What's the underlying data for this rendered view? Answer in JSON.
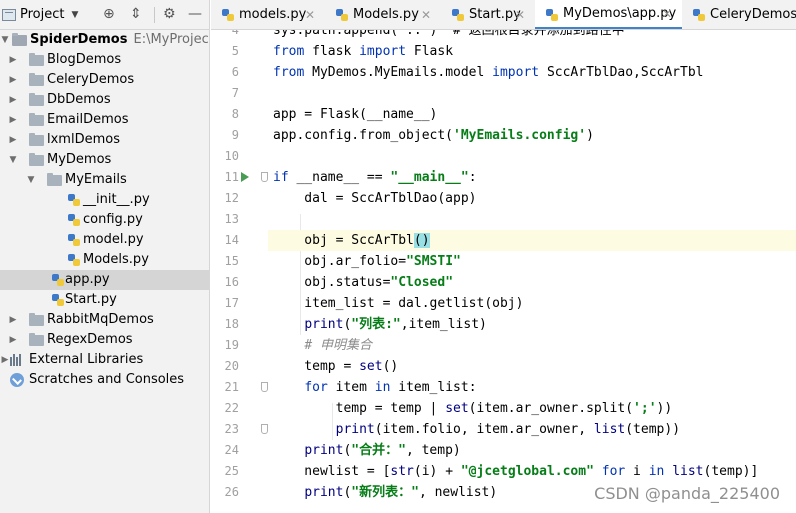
{
  "project_panel": {
    "title": "Project",
    "tools": [
      "locate-icon",
      "collapse-icon",
      "gear-icon",
      "hide-icon"
    ],
    "tree": [
      {
        "label": "SpiderDemos",
        "path": "E:\\MyProject\\My",
        "type": "root",
        "expanded": true,
        "depth": 0
      },
      {
        "label": "BlogDemos",
        "type": "folder",
        "expanded": false,
        "depth": 1
      },
      {
        "label": "CeleryDemos",
        "type": "folder",
        "expanded": false,
        "depth": 1
      },
      {
        "label": "DbDemos",
        "type": "folder",
        "expanded": false,
        "depth": 1
      },
      {
        "label": "EmailDemos",
        "type": "folder",
        "expanded": false,
        "depth": 1
      },
      {
        "label": "lxmlDemos",
        "type": "folder",
        "expanded": false,
        "depth": 1
      },
      {
        "label": "MyDemos",
        "type": "folder",
        "expanded": true,
        "depth": 1
      },
      {
        "label": "MyEmails",
        "type": "folder",
        "expanded": true,
        "depth": 2
      },
      {
        "label": "__init__.py",
        "type": "pyfile",
        "depth": 3
      },
      {
        "label": "config.py",
        "type": "pyfile",
        "depth": 3
      },
      {
        "label": "model.py",
        "type": "pyfile",
        "depth": 3
      },
      {
        "label": "Models.py",
        "type": "pyfile",
        "depth": 3
      },
      {
        "label": "app.py",
        "type": "pyfile",
        "depth": 2,
        "selected": true
      },
      {
        "label": "Start.py",
        "type": "pyfile",
        "depth": 2
      },
      {
        "label": "RabbitMqDemos",
        "type": "folder",
        "expanded": false,
        "depth": 1
      },
      {
        "label": "RegexDemos",
        "type": "folder",
        "expanded": false,
        "depth": 1
      },
      {
        "label": "External Libraries",
        "type": "libs",
        "expanded": false,
        "depth": 0
      },
      {
        "label": "Scratches and Consoles",
        "type": "scratch",
        "depth": 0
      }
    ]
  },
  "tabs": [
    {
      "label": "models.py",
      "active": false
    },
    {
      "label": "Models.py",
      "active": false
    },
    {
      "label": "Start.py",
      "active": false
    },
    {
      "label": "MyDemos\\app.py",
      "active": true
    },
    {
      "label": "CeleryDemos\\a",
      "active": false
    }
  ],
  "editor": {
    "lines": [
      {
        "num": "4",
        "segments": [
          [
            "",
            "sys.path.append(\"..\")  # 返回根目录并添加到路径中"
          ]
        ]
      },
      {
        "num": "5",
        "segments": [
          [
            "kw",
            "from"
          ],
          [
            "",
            " flask "
          ],
          [
            "kw",
            "import"
          ],
          [
            "",
            " Flask"
          ]
        ]
      },
      {
        "num": "6",
        "segments": [
          [
            "kw",
            "from"
          ],
          [
            "",
            " MyDemos.MyEmails.model "
          ],
          [
            "kw",
            "import"
          ],
          [
            "",
            " SccArTblDao,SccArTbl"
          ]
        ]
      },
      {
        "num": "7",
        "segments": []
      },
      {
        "num": "8",
        "segments": [
          [
            "",
            "app = Flask(__name__)"
          ]
        ]
      },
      {
        "num": "9",
        "segments": [
          [
            "",
            "app.config.from_object("
          ],
          [
            "str",
            "'MyEmails.config'"
          ],
          [
            "",
            ")"
          ]
        ]
      },
      {
        "num": "10",
        "segments": []
      },
      {
        "num": "11",
        "segments": [
          [
            "kw",
            "if"
          ],
          [
            "",
            " __name__ == "
          ],
          [
            "str",
            "\"__main__\""
          ],
          [
            "",
            ":"
          ]
        ],
        "run": true,
        "fold": true
      },
      {
        "num": "12",
        "segments": [
          [
            "",
            "    dal = SccArTblDao(app)"
          ]
        ]
      },
      {
        "num": "13",
        "segments": []
      },
      {
        "num": "14",
        "segments": [
          [
            "",
            "    obj = SccArTbl"
          ],
          [
            "cursor",
            "()"
          ]
        ],
        "current": true,
        "bulb": true
      },
      {
        "num": "15",
        "segments": [
          [
            "",
            "    obj.ar_folio="
          ],
          [
            "str",
            "\"SMSTI\""
          ]
        ]
      },
      {
        "num": "16",
        "segments": [
          [
            "",
            "    obj.status="
          ],
          [
            "str",
            "\"Closed\""
          ]
        ]
      },
      {
        "num": "17",
        "segments": [
          [
            "",
            "    item_list = dal.getlist(obj)"
          ]
        ]
      },
      {
        "num": "18",
        "segments": [
          [
            "",
            "    "
          ],
          [
            "bi",
            "print"
          ],
          [
            "",
            "("
          ],
          [
            "str",
            "\"列表:\""
          ],
          [
            "",
            ",item_list)"
          ]
        ]
      },
      {
        "num": "19",
        "segments": [
          [
            "",
            "    "
          ],
          [
            "cmt",
            "# 申明集合"
          ]
        ]
      },
      {
        "num": "20",
        "segments": [
          [
            "",
            "    temp = "
          ],
          [
            "bi",
            "set"
          ],
          [
            "",
            "()"
          ]
        ]
      },
      {
        "num": "21",
        "segments": [
          [
            "",
            "    "
          ],
          [
            "kw",
            "for"
          ],
          [
            "",
            " item "
          ],
          [
            "kw",
            "in"
          ],
          [
            "",
            " item_list:"
          ]
        ],
        "fold": true
      },
      {
        "num": "22",
        "segments": [
          [
            "",
            "        temp = temp | "
          ],
          [
            "bi",
            "set"
          ],
          [
            "",
            "(item.ar_owner.split("
          ],
          [
            "str",
            "';'"
          ],
          [
            "",
            "))"
          ]
        ]
      },
      {
        "num": "23",
        "segments": [
          [
            "",
            "        "
          ],
          [
            "bi",
            "print"
          ],
          [
            "",
            "(item.folio, item.ar_owner, "
          ],
          [
            "bi",
            "list"
          ],
          [
            "",
            "(temp))"
          ]
        ],
        "fold": true
      },
      {
        "num": "24",
        "segments": [
          [
            "",
            "    "
          ],
          [
            "bi",
            "print"
          ],
          [
            "",
            "("
          ],
          [
            "str",
            "\"合并：\""
          ],
          [
            "",
            ", temp)"
          ]
        ]
      },
      {
        "num": "25",
        "segments": [
          [
            "",
            "    newlist = ["
          ],
          [
            "bi",
            "str"
          ],
          [
            "",
            "(i) + "
          ],
          [
            "str",
            "\"@jcetglobal.com\""
          ],
          [
            "",
            " "
          ],
          [
            "kw",
            "for"
          ],
          [
            "",
            " i "
          ],
          [
            "kw",
            "in"
          ],
          [
            "",
            " "
          ],
          [
            "bi",
            "list"
          ],
          [
            "",
            "(temp)]"
          ]
        ]
      },
      {
        "num": "26",
        "segments": [
          [
            "",
            "    "
          ],
          [
            "bi",
            "print"
          ],
          [
            "",
            "("
          ],
          [
            "str",
            "\"新列表：\""
          ],
          [
            "",
            ", newlist)"
          ]
        ]
      }
    ]
  },
  "watermark": "CSDN @panda_225400",
  "colors": {
    "keyword": "#0033b3",
    "string": "#067d17",
    "comment": "#8c8c8c",
    "builtin": "#000080",
    "tab_accent": "#4083c9",
    "run_icon": "#499c54"
  }
}
